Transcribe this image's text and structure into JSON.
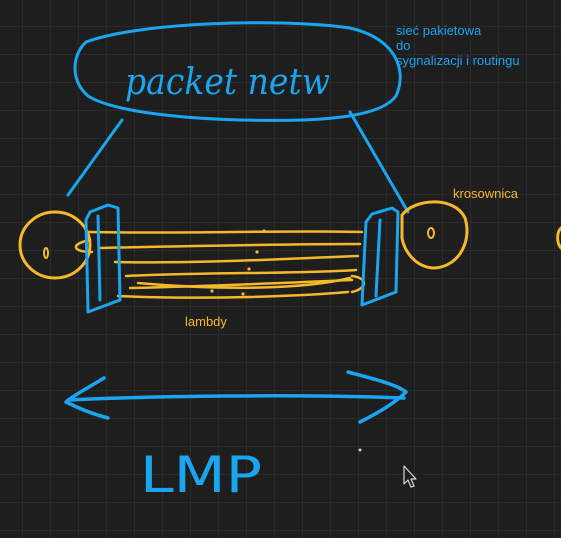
{
  "colors": {
    "blue": "#1aa5f0",
    "orange": "#f5b82a",
    "background": "#1e1e1e",
    "grid": "#2b2b2b"
  },
  "handwritten": {
    "top_label": "packet netw",
    "bottom_label": "LMP"
  },
  "notes": {
    "packet_network_desc": {
      "line1": "sieć pakietowa",
      "line2": "do",
      "line3": "sygnalizacji i routingu"
    },
    "crossconnect": "krosownica",
    "lambdas": "lambdy"
  },
  "icons": {
    "cursor": "mouse-pointer-icon"
  }
}
